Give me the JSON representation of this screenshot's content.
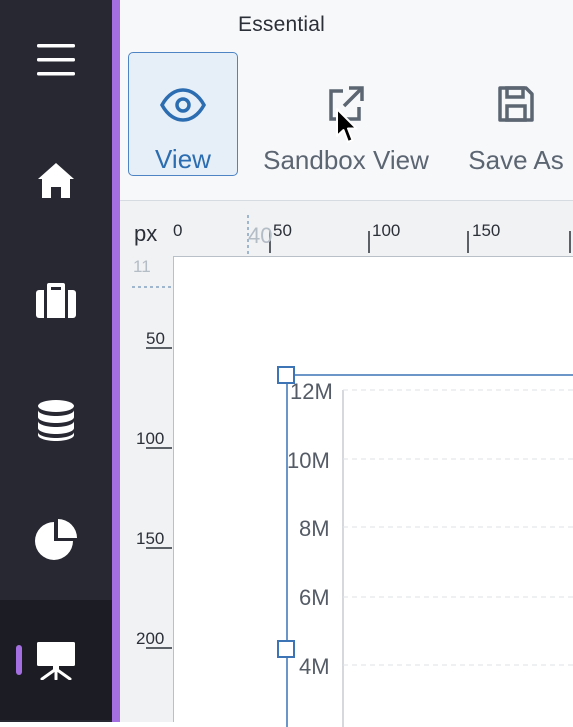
{
  "sidebar": {
    "items": [
      {
        "icon": "menu-icon"
      },
      {
        "icon": "home-icon"
      },
      {
        "icon": "briefcase-icon"
      },
      {
        "icon": "database-icon"
      },
      {
        "icon": "pie-chart-icon"
      },
      {
        "icon": "presentation-icon",
        "active": true
      }
    ],
    "accent_color": "#a46fe0"
  },
  "toolbar": {
    "section_title": "Essential",
    "buttons": [
      {
        "label": "View",
        "icon": "eye-icon",
        "selected": true
      },
      {
        "label": "Sandbox View",
        "icon": "external-link-icon"
      },
      {
        "label": "Save As",
        "icon": "save-icon"
      }
    ]
  },
  "ruler": {
    "unit": "px",
    "top_labels": [
      "0",
      "50",
      "100",
      "150"
    ],
    "top_guide_label": "40",
    "left_labels": [
      "50",
      "100",
      "150",
      "200"
    ],
    "left_guide_label": "11"
  },
  "chart_data": {
    "type": "bar",
    "y_tick_labels": [
      "12M",
      "10M",
      "8M",
      "6M",
      "4M"
    ],
    "grid": true
  }
}
